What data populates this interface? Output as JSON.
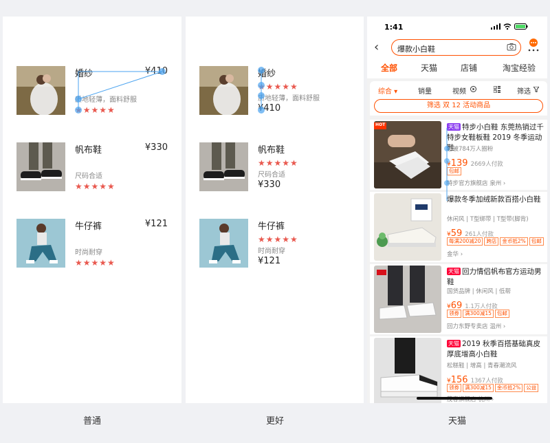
{
  "panels": [
    {
      "caption": "普通",
      "items": [
        {
          "title": "婚纱",
          "price": "¥410",
          "desc": "质地轻薄，面料舒服",
          "stars": "★★★★★"
        },
        {
          "title": "帆布鞋",
          "price": "¥330",
          "desc": "尺码合适",
          "stars": "★★★★★"
        },
        {
          "title": "牛仔裤",
          "price": "¥121",
          "desc": "时尚耐穿",
          "stars": "★★★★★"
        }
      ]
    },
    {
      "caption": "更好",
      "items": [
        {
          "title": "婚纱",
          "price": "¥410",
          "desc": "质地轻薄，面料舒服",
          "stars": "★★★★★"
        },
        {
          "title": "帆布鞋",
          "price": "¥330",
          "desc": "尺码合适",
          "stars": "★★★★★"
        },
        {
          "title": "牛仔裤",
          "price": "¥121",
          "desc": "时尚耐穿",
          "stars": "★★★★★"
        }
      ]
    }
  ],
  "tmall": {
    "caption": "天猫",
    "time": "1:41",
    "search_query": "爆款小白鞋",
    "tabs": [
      "全部",
      "天猫",
      "店铺",
      "淘宝经验"
    ],
    "sort": [
      "综合 ▾",
      "销量",
      "视频",
      "筛选"
    ],
    "promo": "筛选 双 12 活动商品",
    "products": [
      {
        "tag": "天猫",
        "title": "特步小白鞋 东莞热销过千特步女鞋板鞋 2019 冬季运动鞋",
        "sub": "已被784万人圈粉",
        "yen": "¥",
        "price": "139",
        "paid": "2669人付款",
        "chips": [
          "包邮"
        ],
        "shop": "特步官方旗舰店 泉州 ›",
        "hot": "HOT"
      },
      {
        "tag": "",
        "title": "爆款冬季加绒新款百搭小白鞋",
        "sub": "休闲风 | T型绑带 | T型带(脚背)",
        "yen": "¥",
        "price": "59",
        "paid": "261人付款",
        "chips": [
          "每满200减20",
          "跨店",
          "金币抵2%",
          "包邮"
        ],
        "shop": "金华 ›"
      },
      {
        "tag": "天猫",
        "title": "回力情侣帆布官方运动男鞋",
        "sub": "国货品牌 | 休闲风 | 低帮",
        "yen": "¥",
        "price": "69",
        "paid": "1.1万人付款",
        "chips": [
          "领券",
          "满300减15",
          "包邮"
        ],
        "shop": "回力东野专卖店 温州 ›"
      },
      {
        "tag": "天猫",
        "title": "2019 秋季百搭基础真皮厚底增高小白鞋",
        "sub": "松糕鞋 | 增高 | 青春潮流风",
        "yen": "¥",
        "price": "156",
        "paid": "1367人付款",
        "chips": [
          "领券",
          "满300减15",
          "金币抵2%",
          "公益"
        ],
        "shop": "茂春旗舰店 杭州 ›"
      }
    ]
  },
  "colors": {
    "accent": "#ff5000",
    "star": "#e9594f",
    "tmall_red": "#ff0036",
    "overlay": "#4aa3f0"
  }
}
